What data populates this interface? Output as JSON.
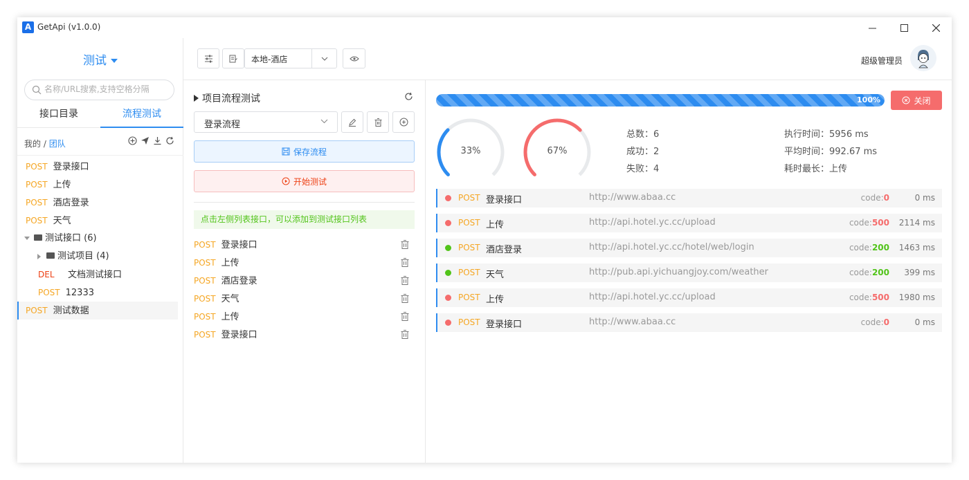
{
  "window": {
    "title": "GetApi (v1.0.0)",
    "logo_letter": "A"
  },
  "sidebar": {
    "project": "测试",
    "search_placeholder": "名称/URL搜索,支持空格分隔",
    "tabs": [
      "接口目录",
      "流程测试"
    ],
    "active_tab": 1,
    "scope_mine": "我的",
    "scope_sep": "/",
    "scope_team": "团队",
    "tree": [
      {
        "method": "POST",
        "name": "登录接口"
      },
      {
        "method": "POST",
        "name": "上传"
      },
      {
        "method": "POST",
        "name": "酒店登录"
      },
      {
        "method": "POST",
        "name": "天气"
      },
      {
        "folder": "测试接口 (6)"
      },
      {
        "folder": "测试项目 (4)"
      },
      {
        "method": "DEL",
        "name": "文档测试接口"
      },
      {
        "method": "POST",
        "name": "12333"
      },
      {
        "method": "POST",
        "name": "测试数据"
      }
    ]
  },
  "toolbar": {
    "environment": "本地-酒店",
    "user_name": "超级管理员"
  },
  "flow_panel": {
    "title": "项目流程测试",
    "selected_flow": "登录流程",
    "save_label": "保存流程",
    "start_label": "开始测试",
    "hint": "点击左侧列表接口，可以添加到测试接口列表",
    "steps": [
      {
        "method": "POST",
        "name": "登录接口"
      },
      {
        "method": "POST",
        "name": "上传"
      },
      {
        "method": "POST",
        "name": "酒店登录"
      },
      {
        "method": "POST",
        "name": "天气"
      },
      {
        "method": "POST",
        "name": "上传"
      },
      {
        "method": "POST",
        "name": "登录接口"
      }
    ]
  },
  "results": {
    "progress_percent": 100,
    "progress_label": "100%",
    "close_label": "关闭",
    "success_gauge": {
      "value": 33,
      "label": "33%",
      "color": "#2d8cf0"
    },
    "fail_gauge": {
      "value": 67,
      "label": "67%",
      "color": "#f56c6c"
    },
    "stats": {
      "total": "总数：6",
      "success": "成功：2",
      "failed": "失败：4",
      "exec_time": "执行时间：5956 ms",
      "avg_time": "平均时间：992.67 ms",
      "longest": "耗时最长：上传"
    },
    "code_prefix": "code:",
    "rows": [
      {
        "status": "fail",
        "method": "POST",
        "name": "登录接口",
        "url": "http://www.abaa.cc",
        "code": "0",
        "ms": "0 ms"
      },
      {
        "status": "fail",
        "method": "POST",
        "name": "上传",
        "url": "http://api.hotel.yc.cc/upload",
        "code": "500",
        "ms": "2114 ms"
      },
      {
        "status": "ok",
        "method": "POST",
        "name": "酒店登录",
        "url": "http://api.hotel.yc.cc/hotel/web/login",
        "code": "200",
        "ms": "1463 ms"
      },
      {
        "status": "ok",
        "method": "POST",
        "name": "天气",
        "url": "http://pub.api.yichuangjoy.com/weather",
        "code": "200",
        "ms": "399 ms"
      },
      {
        "status": "fail",
        "method": "POST",
        "name": "上传",
        "url": "http://api.hotel.yc.cc/upload",
        "code": "500",
        "ms": "1980 ms"
      },
      {
        "status": "fail",
        "method": "POST",
        "name": "登录接口",
        "url": "http://www.abaa.cc",
        "code": "0",
        "ms": "0 ms"
      }
    ]
  },
  "colors": {
    "primary": "#2d8cf0",
    "post": "#f5a623",
    "del": "#ed4014",
    "ok": "#52c41a",
    "fail": "#f56c6c"
  }
}
